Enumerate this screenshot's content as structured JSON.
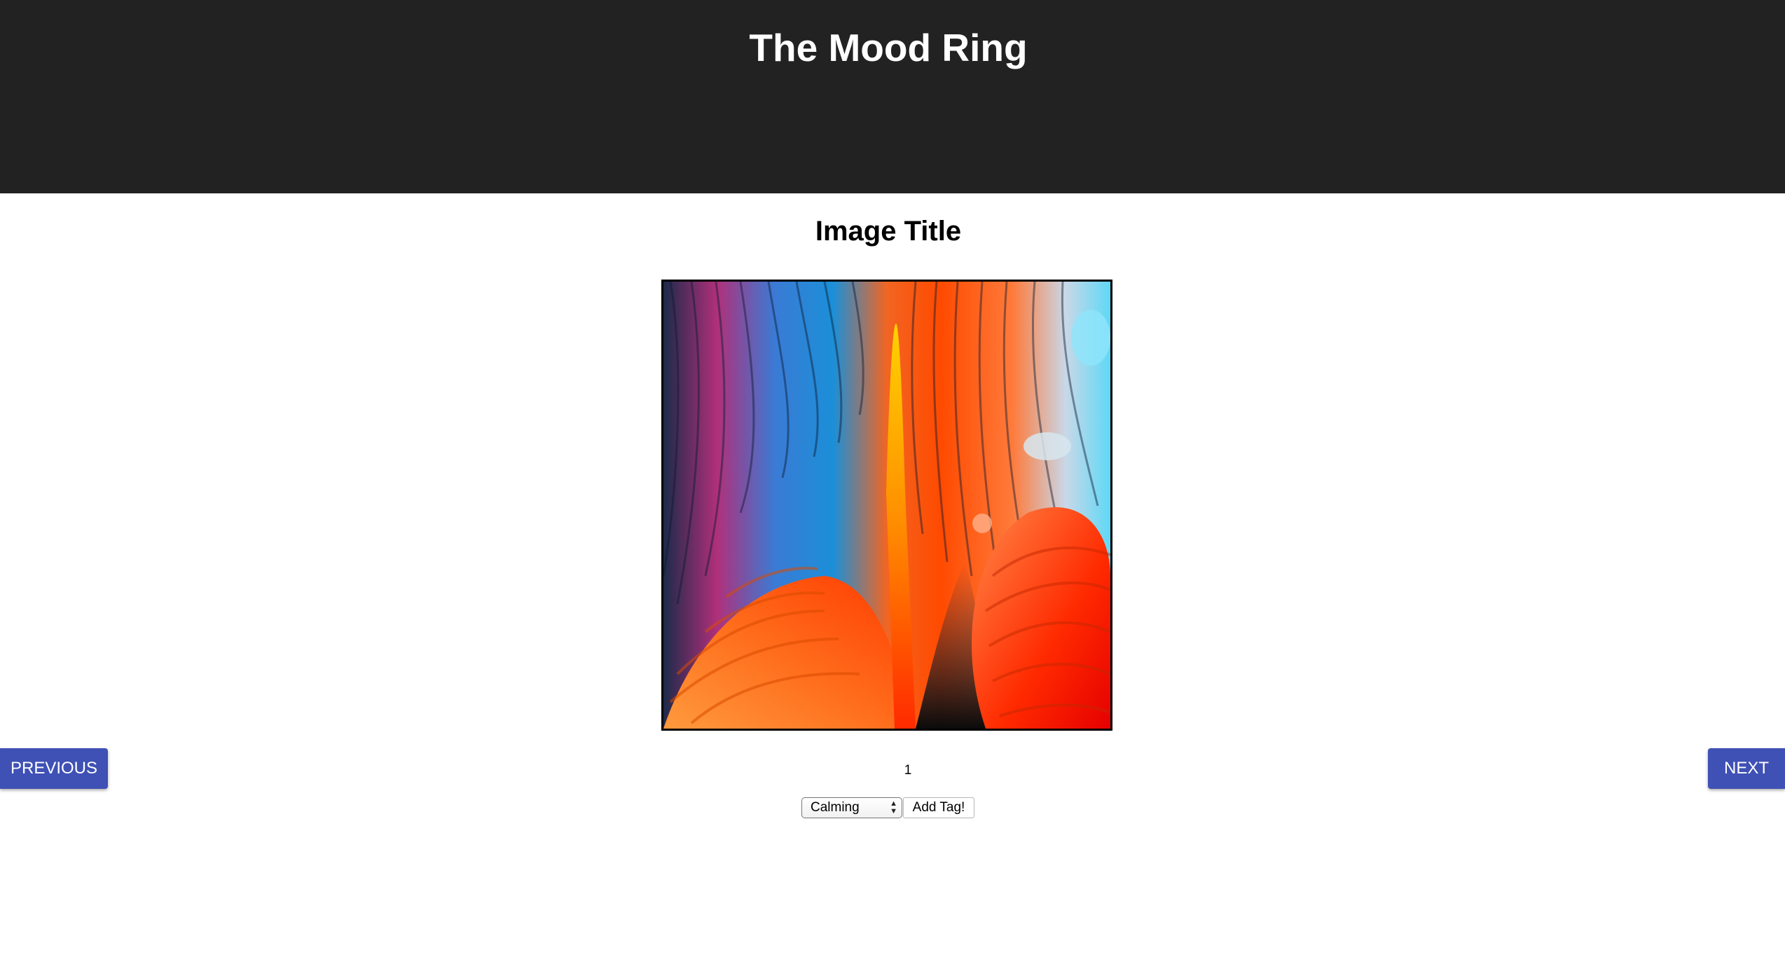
{
  "header": {
    "title": "The Mood Ring",
    "background": "#222222"
  },
  "image": {
    "title": "Image Title",
    "page_number": "1"
  },
  "navigation": {
    "previous_label": "PREVIOUS",
    "next_label": "NEXT",
    "button_color": "#3f51b5"
  },
  "tagging": {
    "selected_tag": "Calming",
    "add_label": "Add Tag!"
  }
}
